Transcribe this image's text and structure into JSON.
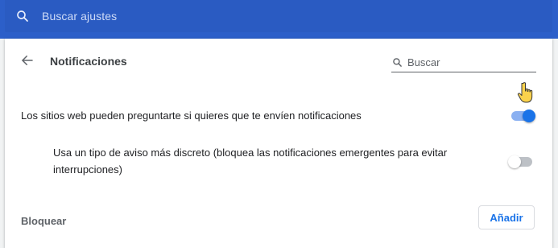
{
  "colors": {
    "topbar": "#2c5fc9",
    "accent": "#1a73e8",
    "background": "#f1f3f4",
    "card": "#ffffff"
  },
  "topbar": {
    "search_placeholder": "Buscar ajustes",
    "search_icon": "search-icon"
  },
  "header": {
    "back_icon": "arrow-back-icon",
    "title": "Notificaciones",
    "search_placeholder": "Buscar",
    "search_icon": "search-icon"
  },
  "settings": {
    "ask_permission": {
      "label": "Los sitios web pueden preguntarte si quieres que te envíen notificaciones",
      "enabled": true
    },
    "quieter_prompts": {
      "label_line1": "Usa un tipo de aviso más discreto (bloquea las notificaciones emergentes para evitar",
      "label_line2": "interrupciones)",
      "enabled": false
    }
  },
  "block_section": {
    "label": "Bloquear",
    "add_button": "Añadir"
  },
  "cursor_icon": "hand-pointer-icon"
}
